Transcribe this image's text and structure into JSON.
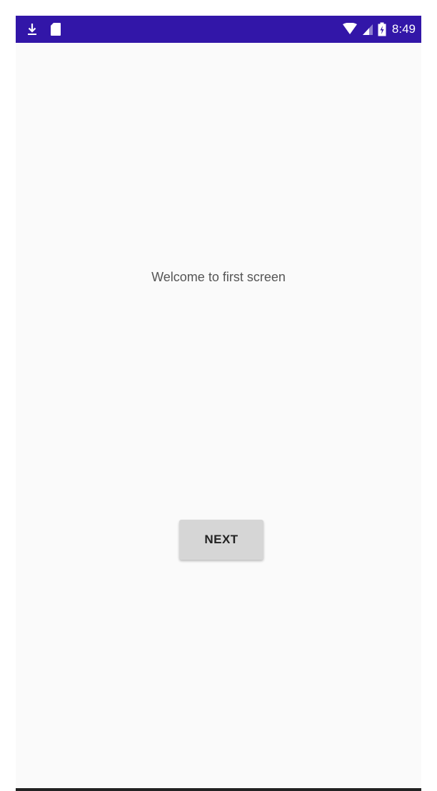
{
  "status_bar": {
    "time": "8:49",
    "background_color": "#3216a8",
    "left_icons": [
      "download-icon",
      "sd-card-icon"
    ],
    "right_icons": [
      "wifi-icon",
      "cell-signal-icon",
      "battery-charging-icon"
    ]
  },
  "main": {
    "welcome_text": "Welcome to first screen",
    "next_button_label": "NEXT"
  }
}
